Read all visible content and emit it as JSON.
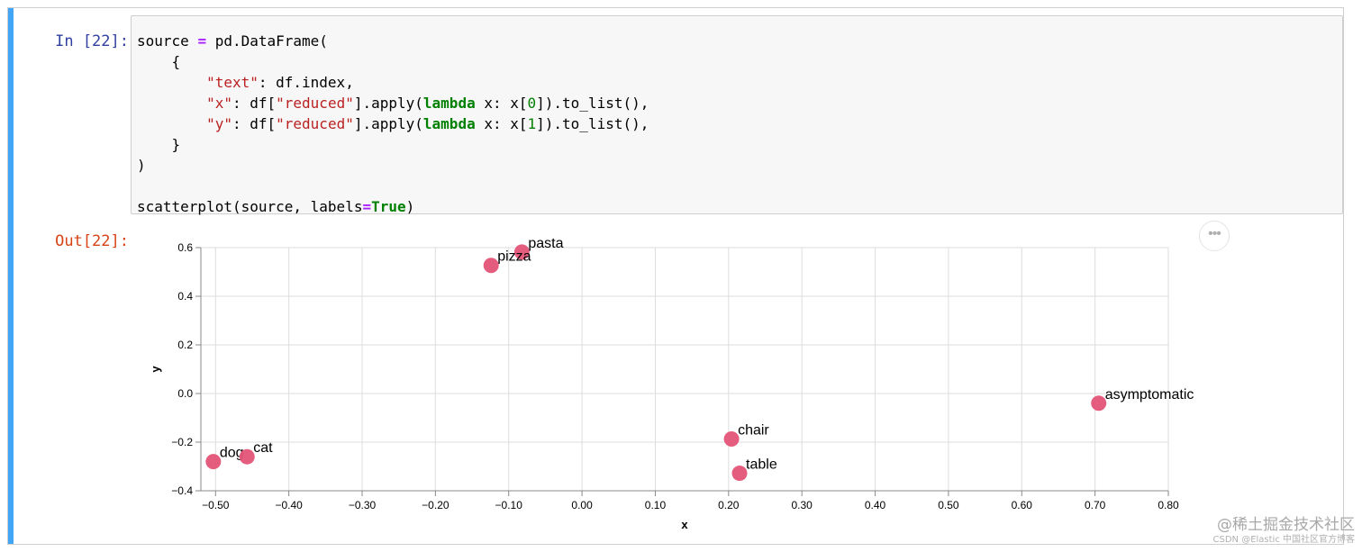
{
  "cell": {
    "in_prompt": "In [22]:",
    "out_prompt": "Out[22]:",
    "accent_color": "#42a5f5",
    "menu_glyph": "•••"
  },
  "code": {
    "lines": [
      [
        [
          "source ",
          ""
        ],
        [
          "=",
          "op"
        ],
        [
          " pd.DataFrame(",
          ""
        ]
      ],
      [
        [
          "    {",
          ""
        ]
      ],
      [
        [
          "        ",
          ""
        ],
        [
          "\"text\"",
          "str"
        ],
        [
          ": df.index,",
          ""
        ]
      ],
      [
        [
          "        ",
          ""
        ],
        [
          "\"x\"",
          "str"
        ],
        [
          ": df[",
          ""
        ],
        [
          "\"reduced\"",
          "str"
        ],
        [
          "].apply(",
          ""
        ],
        [
          "lambda",
          "kw"
        ],
        [
          " x: x[",
          ""
        ],
        [
          "0",
          "num"
        ],
        [
          "]).to_list(),",
          ""
        ]
      ],
      [
        [
          "        ",
          ""
        ],
        [
          "\"y\"",
          "str"
        ],
        [
          ": df[",
          ""
        ],
        [
          "\"reduced\"",
          "str"
        ],
        [
          "].apply(",
          ""
        ],
        [
          "lambda",
          "kw"
        ],
        [
          " x: x[",
          ""
        ],
        [
          "1",
          "num"
        ],
        [
          "]).to_list(),",
          ""
        ]
      ],
      [
        [
          "    }",
          ""
        ]
      ],
      [
        [
          ")",
          ""
        ]
      ],
      [
        [
          "",
          ""
        ]
      ],
      [
        [
          "scatterplot(source, labels",
          ""
        ],
        [
          "=",
          "op"
        ],
        [
          "True",
          "kw"
        ],
        [
          ")",
          ""
        ]
      ]
    ]
  },
  "chart_data": {
    "type": "scatter",
    "title": "",
    "xlabel": "x",
    "ylabel": "y",
    "xlim": [
      -0.52,
      0.8
    ],
    "ylim": [
      -0.4,
      0.6
    ],
    "xticks": [
      "−0.50",
      "−0.40",
      "−0.30",
      "−0.20",
      "−0.10",
      "0.00",
      "0.10",
      "0.20",
      "0.30",
      "0.40",
      "0.50",
      "0.60",
      "0.70",
      "0.80"
    ],
    "xtick_values": [
      -0.5,
      -0.4,
      -0.3,
      -0.2,
      -0.1,
      0.0,
      0.1,
      0.2,
      0.3,
      0.4,
      0.5,
      0.6,
      0.7,
      0.8
    ],
    "yticks": [
      "0.6",
      "0.4",
      "0.2",
      "0.0",
      "−0.2",
      "−0.4"
    ],
    "ytick_values": [
      0.6,
      0.4,
      0.2,
      0.0,
      -0.2,
      -0.4
    ],
    "grid": true,
    "point_color": "#e45477",
    "points": [
      {
        "text": "pasta",
        "x": -0.082,
        "y": 0.582
      },
      {
        "text": "pizza",
        "x": -0.124,
        "y": 0.527
      },
      {
        "text": "dog",
        "x": -0.503,
        "y": -0.28
      },
      {
        "text": "cat",
        "x": -0.457,
        "y": -0.26
      },
      {
        "text": "chair",
        "x": 0.204,
        "y": -0.187
      },
      {
        "text": "table",
        "x": 0.215,
        "y": -0.328
      },
      {
        "text": "asymptomatic",
        "x": 0.705,
        "y": -0.04
      }
    ]
  },
  "watermark": {
    "line1": "@稀土掘金技术社区",
    "line2": "CSDN @Elastic 中国社区官方博客"
  }
}
